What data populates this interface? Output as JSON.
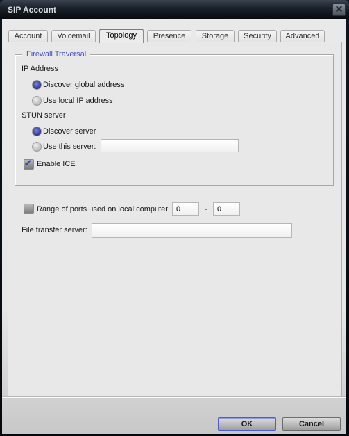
{
  "window": {
    "title": "SIP Account",
    "close_icon": "close-x-icon"
  },
  "tabs": [
    {
      "label": "Account",
      "active": false
    },
    {
      "label": "Voicemail",
      "active": false
    },
    {
      "label": "Topology",
      "active": true
    },
    {
      "label": "Presence",
      "active": false
    },
    {
      "label": "Storage",
      "active": false
    },
    {
      "label": "Security",
      "active": false
    },
    {
      "label": "Advanced",
      "active": false
    }
  ],
  "firewall": {
    "legend": "Firewall Traversal",
    "ip_address": {
      "label": "IP Address",
      "options": [
        {
          "label": "Discover global address",
          "checked": true
        },
        {
          "label": "Use local IP address",
          "checked": false
        }
      ]
    },
    "stun": {
      "label": "STUN server",
      "options": [
        {
          "label": "Discover server",
          "checked": true
        },
        {
          "label": "Use this server:",
          "checked": false
        }
      ],
      "server_value": ""
    },
    "enable_ice": {
      "label": "Enable ICE",
      "checked": true
    }
  },
  "ports": {
    "label": "Range of ports used on local computer:",
    "checked": false,
    "from": "0",
    "separator": "-",
    "to": "0"
  },
  "file_transfer": {
    "label": "File transfer server:",
    "value": ""
  },
  "buttons": {
    "ok": "OK",
    "cancel": "Cancel"
  }
}
